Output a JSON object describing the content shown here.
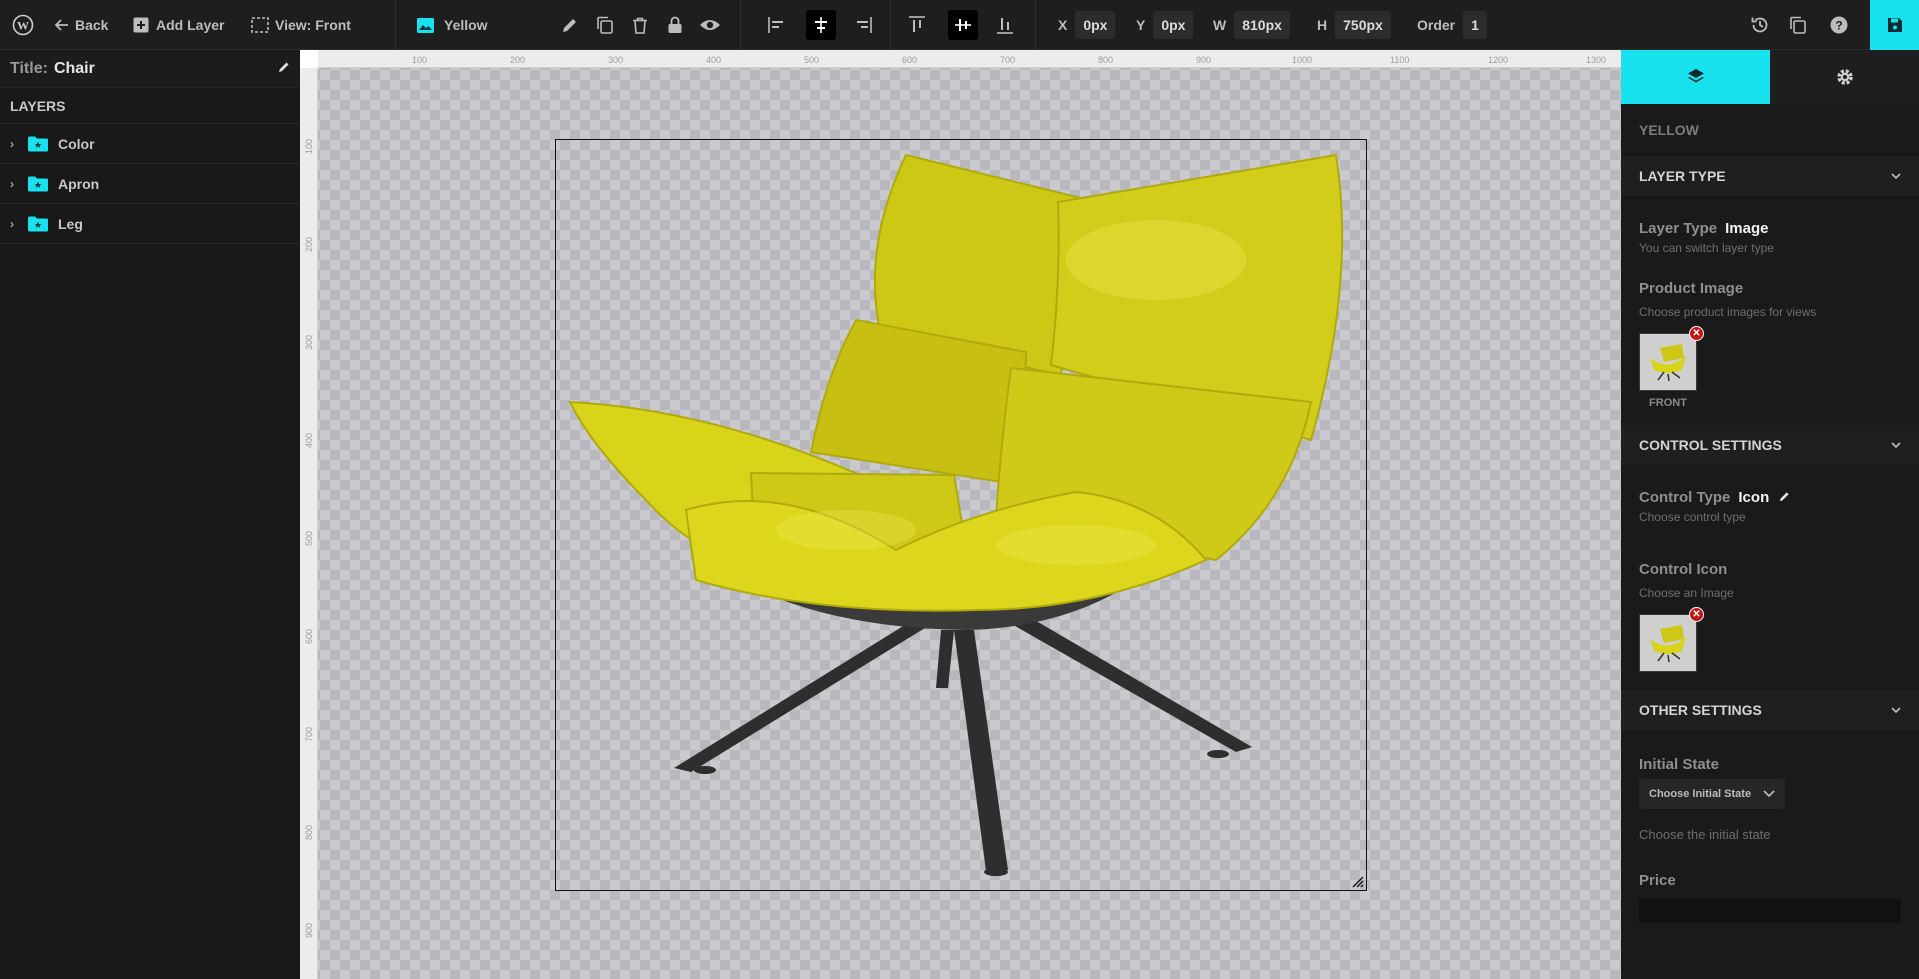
{
  "toolbar": {
    "back_label": "Back",
    "add_layer_label": "Add Layer",
    "view_label": "View: Front",
    "current_layer": "Yellow",
    "x_label": "X",
    "x_value": "0px",
    "y_label": "Y",
    "y_value": "0px",
    "w_label": "W",
    "w_value": "810px",
    "h_label": "H",
    "h_value": "750px",
    "order_label": "Order",
    "order_value": "1"
  },
  "sidebar": {
    "title_key": "Title:",
    "title_value": "Chair",
    "layers_header": "LAYERS",
    "layers": [
      {
        "label": "Color"
      },
      {
        "label": "Apron"
      },
      {
        "label": "Leg"
      }
    ]
  },
  "ruler": {
    "h_ticks": [
      "100",
      "200",
      "300",
      "400",
      "500",
      "600",
      "700",
      "800",
      "900",
      "1000",
      "1100",
      "1200",
      "1300"
    ],
    "v_ticks": [
      "100",
      "200",
      "300",
      "400",
      "500",
      "600",
      "700",
      "800",
      "900"
    ]
  },
  "panel": {
    "layer_name": "YELLOW",
    "layer_type_section": "LAYER TYPE",
    "layer_type_label": "Layer Type",
    "layer_type_value": "Image",
    "layer_type_desc": "You can switch layer type",
    "product_image_label": "Product Image",
    "product_image_desc": "Choose product images for views",
    "product_image_caption": "FRONT",
    "control_section": "CONTROL SETTINGS",
    "control_type_label": "Control Type",
    "control_type_value": "Icon",
    "control_type_desc": "Choose control type",
    "control_icon_label": "Control Icon",
    "control_icon_desc": "Choose an Image",
    "other_section": "OTHER SETTINGS",
    "initial_state_label": "Initial State",
    "initial_state_select": "Choose Initial State",
    "initial_state_desc": "Choose the initial state",
    "price_label": "Price"
  },
  "colors": {
    "accent": "#18e2ee",
    "folder": "#18e2ee",
    "remove": "#c41616",
    "chair": "#d8d41a"
  }
}
